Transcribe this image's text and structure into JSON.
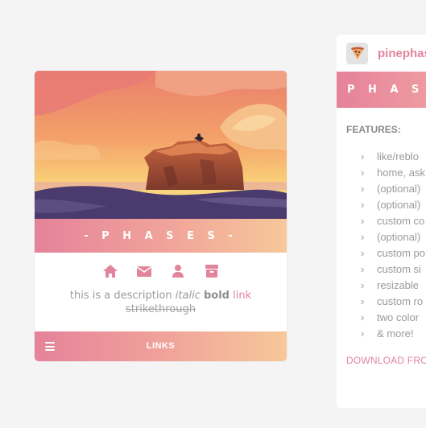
{
  "card": {
    "title": "- P H A S E S -",
    "icons": [
      "home-icon",
      "mail-icon",
      "user-icon",
      "archive-icon"
    ],
    "description": {
      "text": "this is a description",
      "italic": "italic",
      "bold": "bold",
      "link": "link",
      "strike": "strikethrough"
    },
    "links_label": "LINKS",
    "accent_gradient": [
      "#e5829a",
      "#f6c89a"
    ]
  },
  "panel": {
    "blog_name": "pinephas",
    "band_title": "P H A S E S",
    "features_label": "FEATURES:",
    "features": [
      "like/reblo",
      "home, ask",
      "(optional)",
      "(optional)",
      "custom co",
      "(optional)",
      "custom po",
      "custom si",
      "resizable",
      "custom ro",
      "two color",
      "& more!"
    ],
    "download": "DOWNLOAD FRO"
  },
  "colors": {
    "accent": "#e2849c",
    "text_muted": "#9a9a9a",
    "background": "#f4f4f4"
  }
}
